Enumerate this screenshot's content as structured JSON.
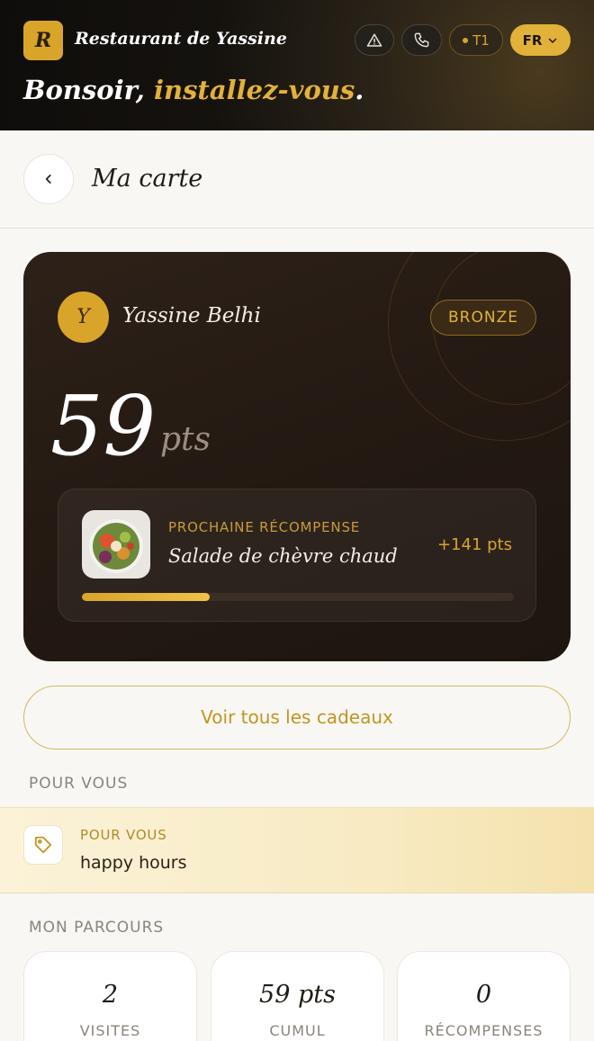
{
  "header": {
    "logo_letter": "R",
    "brand": "Restaurant de Yassine",
    "table_label": "T1",
    "language": "FR",
    "greeting_prefix": "Bonsoir,",
    "greeting_accent": "installez-vous",
    "greeting_suffix": "."
  },
  "page": {
    "title": "Ma carte"
  },
  "card": {
    "avatar_letter": "Y",
    "member_name": "Yassine Belhi",
    "tier": "BRONZE",
    "points": "59",
    "points_unit": "pts",
    "next_reward": {
      "label": "PROCHAINE RÉCOMPENSE",
      "name": "Salade de chèvre chaud",
      "remaining": "+141 pts",
      "progress_fraction": 0.295
    }
  },
  "actions": {
    "gifts_button": "Voir tous les cadeaux"
  },
  "for_you": {
    "section_title": "POUR VOUS",
    "promo_label": "POUR VOUS",
    "promo_text": "happy hours"
  },
  "journey": {
    "section_title": "MON PARCOURS",
    "stats": [
      {
        "value": "2",
        "label": "VISITES"
      },
      {
        "value": "59 pts",
        "label": "CUMUL"
      },
      {
        "value": "0",
        "label": "RÉCOMPENSES"
      }
    ]
  },
  "colors": {
    "accent_gold": "#d8a42a",
    "card_dark": "#231912",
    "background": "#f8f7f3"
  }
}
